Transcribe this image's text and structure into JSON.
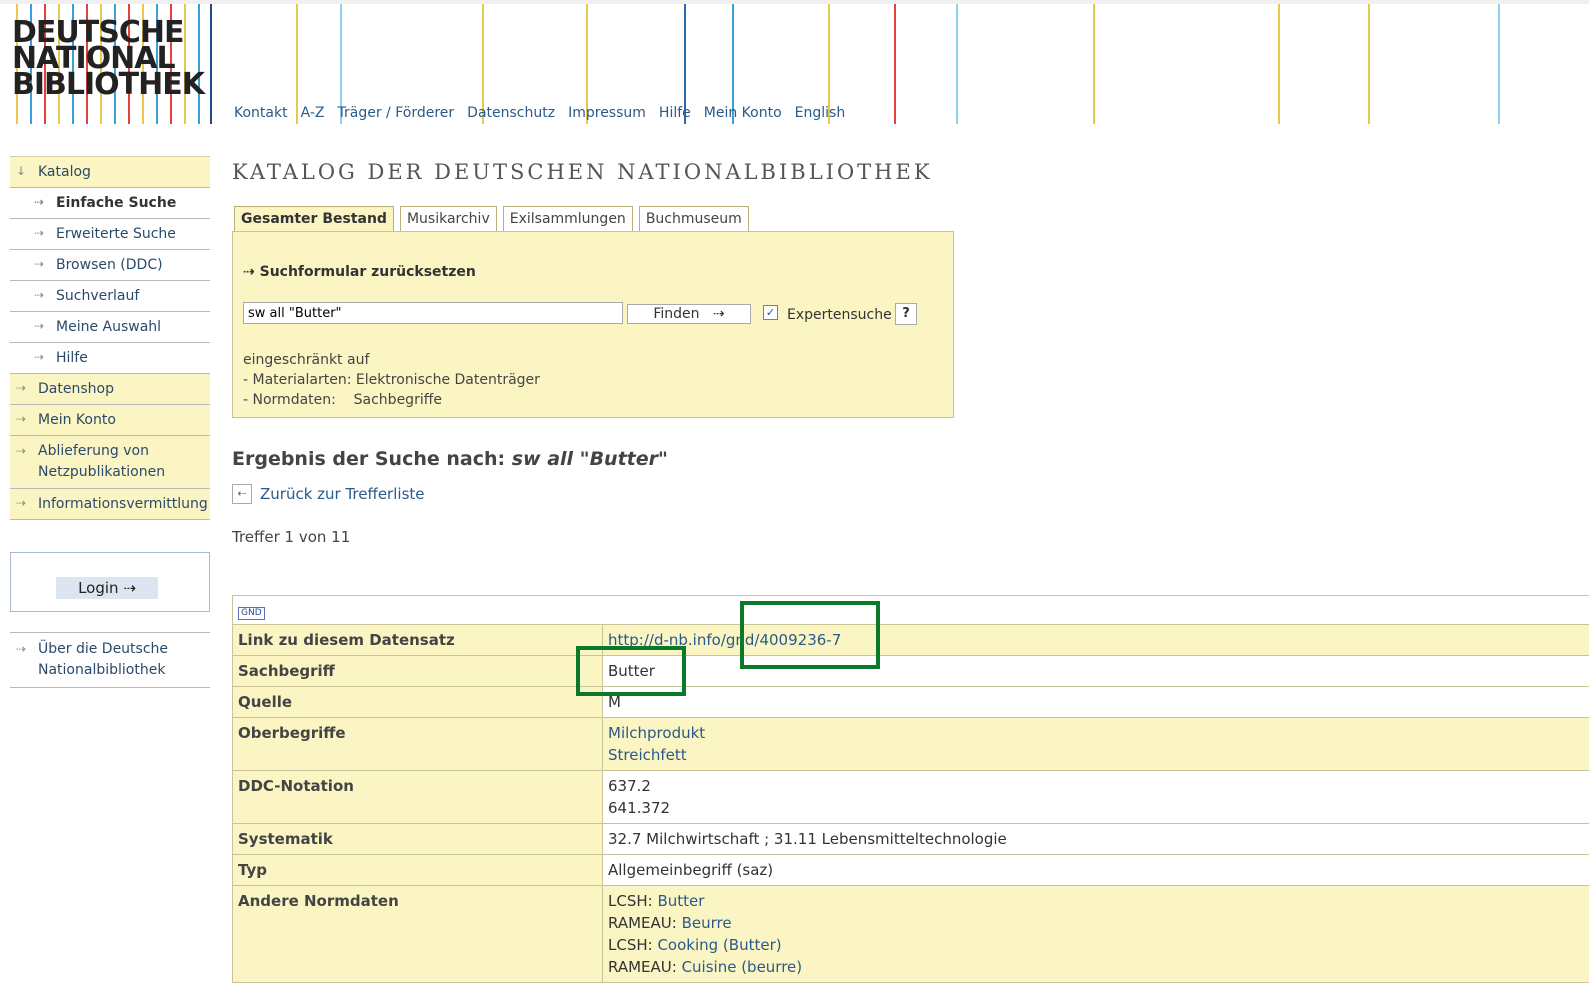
{
  "logo": [
    "DEUTSCHE",
    "NATIONAL",
    "BIBLIOTHEK"
  ],
  "topnav": [
    "Kontakt",
    "A-Z",
    "Träger / Förderer",
    "Datenschutz",
    "Impressum",
    "Hilfe",
    "Mein Konto",
    "English"
  ],
  "sidebar": {
    "katalog": "Katalog",
    "sub": [
      "Einfache Suche",
      "Erweiterte Suche",
      "Browsen (DDC)",
      "Suchverlauf",
      "Meine Auswahl",
      "Hilfe"
    ],
    "datenshop": "Datenshop",
    "mein_konto": "Mein Konto",
    "ablieferung_1": "Ablieferung von",
    "ablieferung_2": "Netzpublikationen",
    "info": "Informationsvermittlung",
    "login": "Login",
    "about_1": "Über die Deutsche",
    "about_2": "Nationalbibliothek"
  },
  "main": {
    "title": "KATALOG DER DEUTSCHEN NATIONALBIBLIOTHEK",
    "tabs": [
      "Gesamter Bestand",
      "Musikarchiv",
      "Exilsammlungen",
      "Buchmuseum"
    ],
    "reset": "Suchformular zurücksetzen",
    "query": "sw all \"Butter\"",
    "find": "Finden",
    "expert": "Expertensuche",
    "help": "?",
    "restrict": [
      "eingeschränkt auf",
      "- Materialarten: Elektronische Datenträger",
      "- Normdaten:    Sachbegriffe"
    ],
    "result_prefix": "Ergebnis der Suche nach: ",
    "result_query": "sw all \"Butter\"",
    "back": "Zurück zur Trefferliste",
    "hits": "Treffer 1 von 11"
  },
  "record": {
    "gnd_badge": "GND",
    "link_label": "Link zu diesem Datensatz",
    "link_value": "http://d-nb.info/gnd/4009236-7",
    "sachbegriff_label": "Sachbegriff",
    "sachbegriff_value": "Butter",
    "quelle_label": "Quelle",
    "quelle_value": "M",
    "ober_label": "Oberbegriffe",
    "ober_1": "Milchprodukt",
    "ober_2": "Streichfett",
    "ddc_label": "DDC-Notation",
    "ddc_1": "637.2",
    "ddc_2": "641.372",
    "syst_label": "Systematik",
    "syst_value": "32.7 Milchwirtschaft ; 31.11 Lebensmitteltechnologie",
    "typ_label": "Typ",
    "typ_value": "Allgemeinbegriff (saz)",
    "andere_label": "Andere Normdaten",
    "andere": [
      {
        "prefix": "LCSH: ",
        "link": "Butter"
      },
      {
        "prefix": "RAMEAU: ",
        "link": "Beurre"
      },
      {
        "prefix": "LCSH: ",
        "link": "Cooking (Butter)"
      },
      {
        "prefix": "RAMEAU: ",
        "link": "Cuisine (beurre)"
      }
    ]
  },
  "colors": {
    "highlight": "#0a7a2a",
    "panel": "#fbf5c4",
    "link": "#2a5a8a"
  }
}
